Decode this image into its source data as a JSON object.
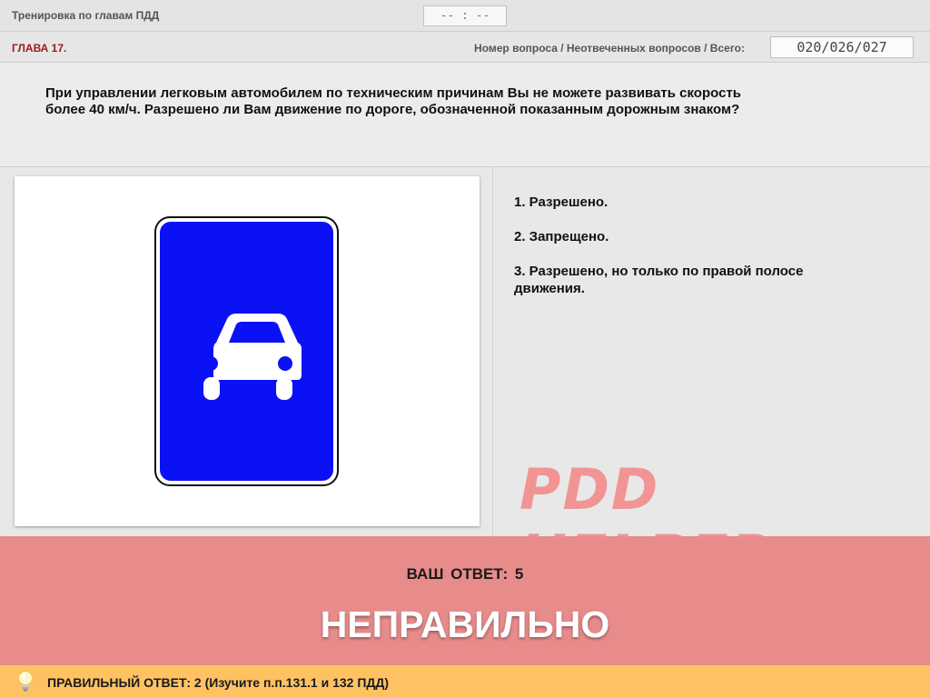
{
  "topbar": {
    "title": "Тренировка по главам ПДД",
    "timer": "-- : --"
  },
  "infobar": {
    "chapter": "ГЛАВА 17.",
    "counter_label": "Номер вопроса / Неотвеченных вопросов / Всего:",
    "counter_value": "020/026/027"
  },
  "question": {
    "text": "При управлении легковым автомобилем по техническим причинам Вы не можете развивать скорость более 40 км/ч. Разрешено ли Вам движение по дороге, обозначенной показанным дорожным знаком?"
  },
  "image": {
    "icon": "road-sign-car-icon",
    "sign_color": "#0a12f5"
  },
  "answers": [
    {
      "label": "1.  Разрешено."
    },
    {
      "label": "2.  Запрещено."
    },
    {
      "label": "3.  Разрешено, но только по правой полосе движения."
    }
  ],
  "watermark": "PDD HELPER",
  "result": {
    "your_answer": "ВАШ  ОТВЕТ:   5",
    "verdict": "НЕПРАВИЛЬНО",
    "color": "#e88b8b"
  },
  "correct": {
    "text": "ПРАВИЛЬНЫЙ ОТВЕТ:   2   (Изучите п.п.131.1 и 132 ПДД)",
    "icon": "lightbulb-icon",
    "color": "#fec263"
  }
}
